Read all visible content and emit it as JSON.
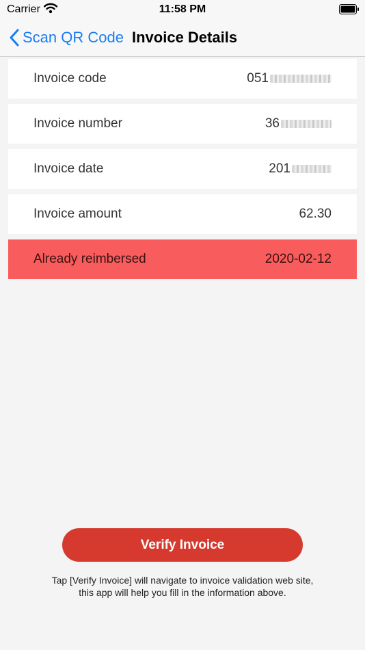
{
  "status_bar": {
    "carrier": "Carrier",
    "time": "11:58 PM"
  },
  "nav": {
    "back_label": "Scan QR Code",
    "title": "Invoice Details"
  },
  "rows": [
    {
      "label": "Invoice code",
      "value": "051"
    },
    {
      "label": "Invoice number",
      "value": "36"
    },
    {
      "label": "Invoice date",
      "value": "201"
    },
    {
      "label": "Invoice amount",
      "value": "62.30"
    },
    {
      "label": "Already reimbersed",
      "value": "2020-02-12"
    }
  ],
  "verify_button_label": "Verify Invoice",
  "hint_line1": "Tap [Verify Invoice] will navigate to invoice validation web site,",
  "hint_line2": "this app will help you fill in the information above.",
  "colors": {
    "accent": "#1a7cf0",
    "alert": "#f85c5c",
    "button": "#d63a2e"
  }
}
